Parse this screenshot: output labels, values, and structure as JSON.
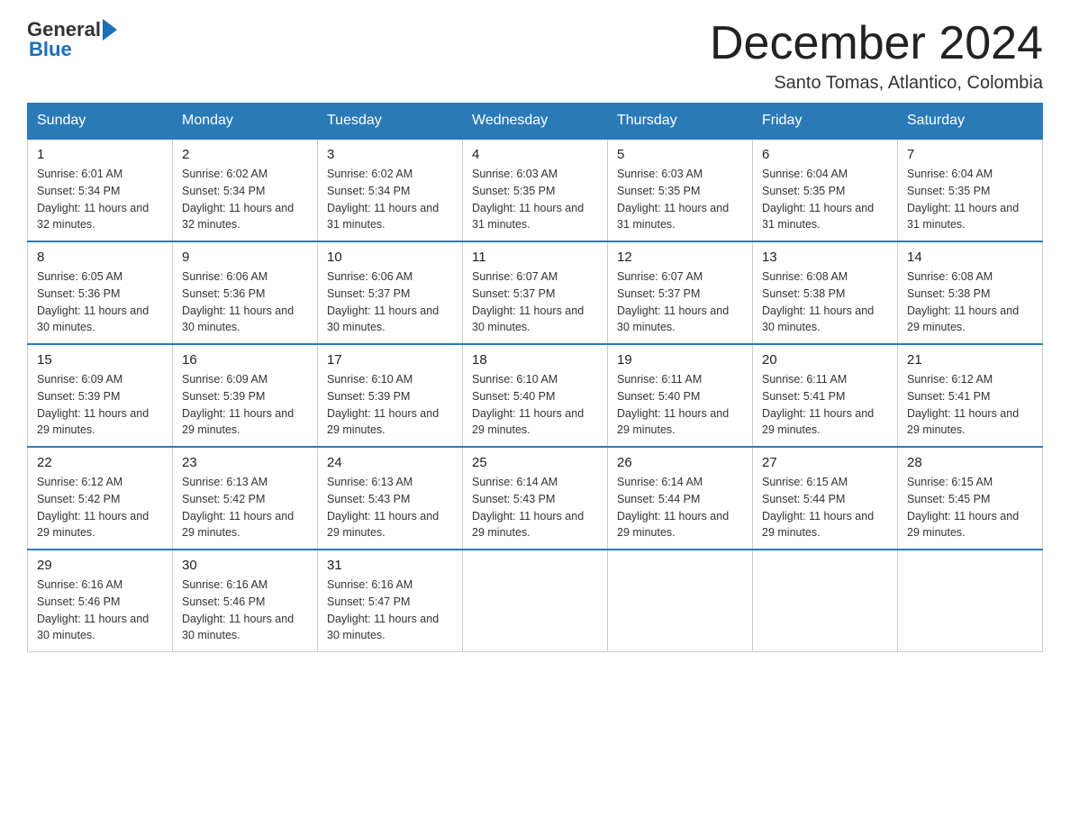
{
  "header": {
    "logo_general": "General",
    "logo_blue": "Blue",
    "month_title": "December 2024",
    "subtitle": "Santo Tomas, Atlantico, Colombia"
  },
  "days_of_week": [
    "Sunday",
    "Monday",
    "Tuesday",
    "Wednesday",
    "Thursday",
    "Friday",
    "Saturday"
  ],
  "weeks": [
    [
      {
        "num": "1",
        "sunrise": "6:01 AM",
        "sunset": "5:34 PM",
        "daylight": "11 hours and 32 minutes."
      },
      {
        "num": "2",
        "sunrise": "6:02 AM",
        "sunset": "5:34 PM",
        "daylight": "11 hours and 32 minutes."
      },
      {
        "num": "3",
        "sunrise": "6:02 AM",
        "sunset": "5:34 PM",
        "daylight": "11 hours and 31 minutes."
      },
      {
        "num": "4",
        "sunrise": "6:03 AM",
        "sunset": "5:35 PM",
        "daylight": "11 hours and 31 minutes."
      },
      {
        "num": "5",
        "sunrise": "6:03 AM",
        "sunset": "5:35 PM",
        "daylight": "11 hours and 31 minutes."
      },
      {
        "num": "6",
        "sunrise": "6:04 AM",
        "sunset": "5:35 PM",
        "daylight": "11 hours and 31 minutes."
      },
      {
        "num": "7",
        "sunrise": "6:04 AM",
        "sunset": "5:35 PM",
        "daylight": "11 hours and 31 minutes."
      }
    ],
    [
      {
        "num": "8",
        "sunrise": "6:05 AM",
        "sunset": "5:36 PM",
        "daylight": "11 hours and 30 minutes."
      },
      {
        "num": "9",
        "sunrise": "6:06 AM",
        "sunset": "5:36 PM",
        "daylight": "11 hours and 30 minutes."
      },
      {
        "num": "10",
        "sunrise": "6:06 AM",
        "sunset": "5:37 PM",
        "daylight": "11 hours and 30 minutes."
      },
      {
        "num": "11",
        "sunrise": "6:07 AM",
        "sunset": "5:37 PM",
        "daylight": "11 hours and 30 minutes."
      },
      {
        "num": "12",
        "sunrise": "6:07 AM",
        "sunset": "5:37 PM",
        "daylight": "11 hours and 30 minutes."
      },
      {
        "num": "13",
        "sunrise": "6:08 AM",
        "sunset": "5:38 PM",
        "daylight": "11 hours and 30 minutes."
      },
      {
        "num": "14",
        "sunrise": "6:08 AM",
        "sunset": "5:38 PM",
        "daylight": "11 hours and 29 minutes."
      }
    ],
    [
      {
        "num": "15",
        "sunrise": "6:09 AM",
        "sunset": "5:39 PM",
        "daylight": "11 hours and 29 minutes."
      },
      {
        "num": "16",
        "sunrise": "6:09 AM",
        "sunset": "5:39 PM",
        "daylight": "11 hours and 29 minutes."
      },
      {
        "num": "17",
        "sunrise": "6:10 AM",
        "sunset": "5:39 PM",
        "daylight": "11 hours and 29 minutes."
      },
      {
        "num": "18",
        "sunrise": "6:10 AM",
        "sunset": "5:40 PM",
        "daylight": "11 hours and 29 minutes."
      },
      {
        "num": "19",
        "sunrise": "6:11 AM",
        "sunset": "5:40 PM",
        "daylight": "11 hours and 29 minutes."
      },
      {
        "num": "20",
        "sunrise": "6:11 AM",
        "sunset": "5:41 PM",
        "daylight": "11 hours and 29 minutes."
      },
      {
        "num": "21",
        "sunrise": "6:12 AM",
        "sunset": "5:41 PM",
        "daylight": "11 hours and 29 minutes."
      }
    ],
    [
      {
        "num": "22",
        "sunrise": "6:12 AM",
        "sunset": "5:42 PM",
        "daylight": "11 hours and 29 minutes."
      },
      {
        "num": "23",
        "sunrise": "6:13 AM",
        "sunset": "5:42 PM",
        "daylight": "11 hours and 29 minutes."
      },
      {
        "num": "24",
        "sunrise": "6:13 AM",
        "sunset": "5:43 PM",
        "daylight": "11 hours and 29 minutes."
      },
      {
        "num": "25",
        "sunrise": "6:14 AM",
        "sunset": "5:43 PM",
        "daylight": "11 hours and 29 minutes."
      },
      {
        "num": "26",
        "sunrise": "6:14 AM",
        "sunset": "5:44 PM",
        "daylight": "11 hours and 29 minutes."
      },
      {
        "num": "27",
        "sunrise": "6:15 AM",
        "sunset": "5:44 PM",
        "daylight": "11 hours and 29 minutes."
      },
      {
        "num": "28",
        "sunrise": "6:15 AM",
        "sunset": "5:45 PM",
        "daylight": "11 hours and 29 minutes."
      }
    ],
    [
      {
        "num": "29",
        "sunrise": "6:16 AM",
        "sunset": "5:46 PM",
        "daylight": "11 hours and 30 minutes."
      },
      {
        "num": "30",
        "sunrise": "6:16 AM",
        "sunset": "5:46 PM",
        "daylight": "11 hours and 30 minutes."
      },
      {
        "num": "31",
        "sunrise": "6:16 AM",
        "sunset": "5:47 PM",
        "daylight": "11 hours and 30 minutes."
      },
      null,
      null,
      null,
      null
    ]
  ],
  "labels": {
    "sunrise_prefix": "Sunrise: ",
    "sunset_prefix": "Sunset: ",
    "daylight_prefix": "Daylight: "
  }
}
